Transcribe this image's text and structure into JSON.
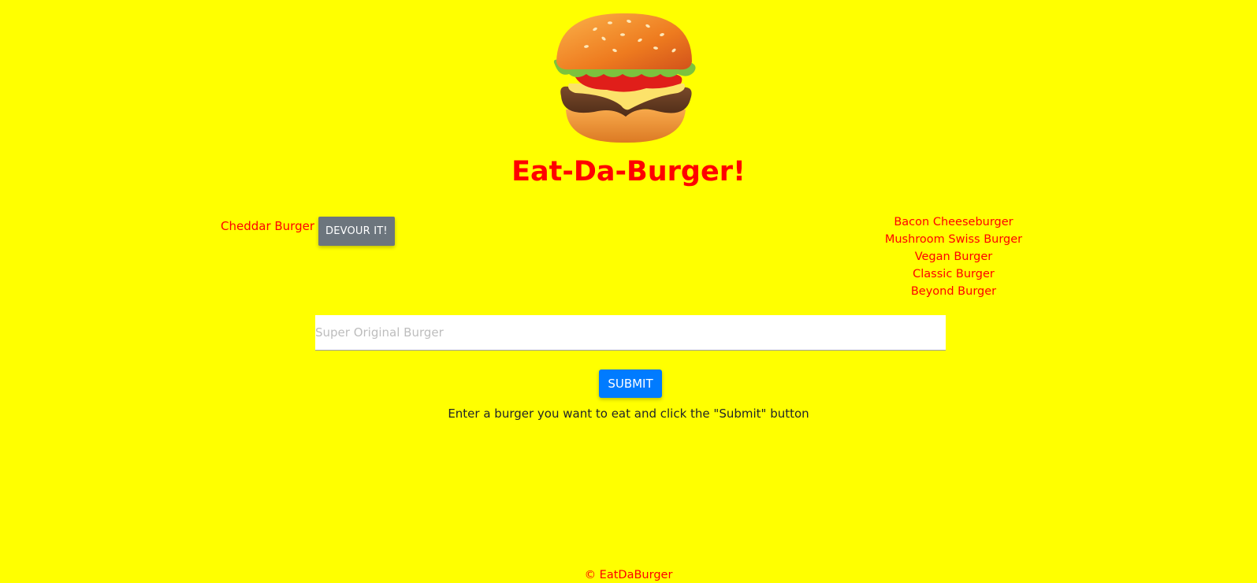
{
  "header": {
    "logo_icon": "hamburger-icon",
    "title": "Eat-Da-Burger!"
  },
  "not_devoured": [
    {
      "name": "Cheddar Burger",
      "button_label": "DEVOUR IT!"
    }
  ],
  "devoured": [
    "Bacon Cheeseburger",
    "Mushroom Swiss Burger",
    "Vegan Burger",
    "Classic Burger",
    "Beyond Burger"
  ],
  "form": {
    "input_value": "",
    "input_placeholder": "Super Original Burger",
    "submit_label": "SUBMIT",
    "instructions": "Enter a burger you want to eat and click the \"Submit\" button"
  },
  "footer": {
    "text": "© EatDaBurger"
  },
  "colors": {
    "background": "#ffff00",
    "title": "#ff0000",
    "devour_button": "#6c757d",
    "submit_button": "#007bff"
  }
}
